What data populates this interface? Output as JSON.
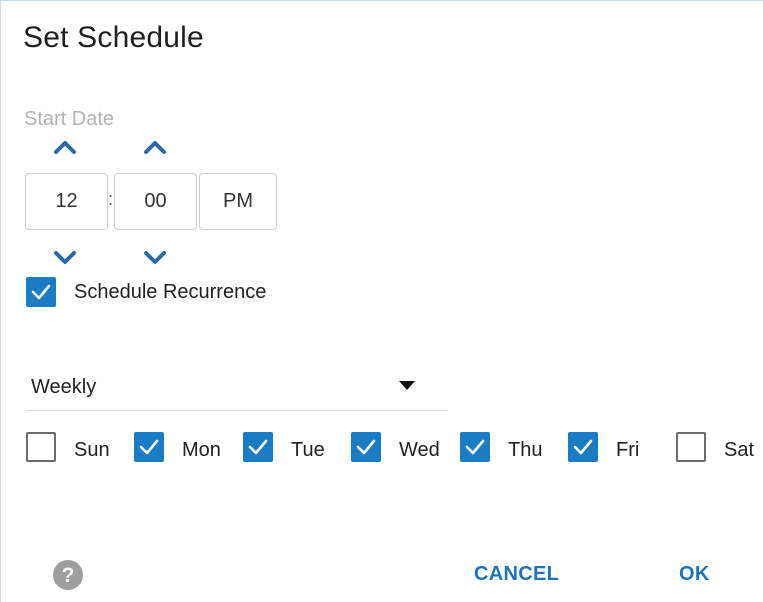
{
  "dialog": {
    "title": "Set Schedule"
  },
  "start_date": {
    "label": "Start Date",
    "hour": "12",
    "separator": ":",
    "minute": "00",
    "period": "PM",
    "icons": {
      "increment": "chevron-up-icon",
      "decrement": "chevron-down-icon"
    }
  },
  "recurrence": {
    "label": "Schedule Recurrence",
    "checked": true
  },
  "frequency": {
    "selected": "Weekly",
    "icon": "caret-down-icon"
  },
  "days": [
    {
      "label": "Sun",
      "checked": false
    },
    {
      "label": "Mon",
      "checked": true
    },
    {
      "label": "Tue",
      "checked": true
    },
    {
      "label": "Wed",
      "checked": true
    },
    {
      "label": "Thu",
      "checked": true
    },
    {
      "label": "Fri",
      "checked": true
    },
    {
      "label": "Sat",
      "checked": false
    }
  ],
  "actions": {
    "help_icon": "question-circle-icon",
    "cancel_label": "CANCEL",
    "ok_label": "OK"
  },
  "colors": {
    "accent": "#1a7cc4",
    "chevron": "#2b6aa6",
    "help_icon": "#9e9e9e",
    "button_text": "#1f73ba"
  }
}
